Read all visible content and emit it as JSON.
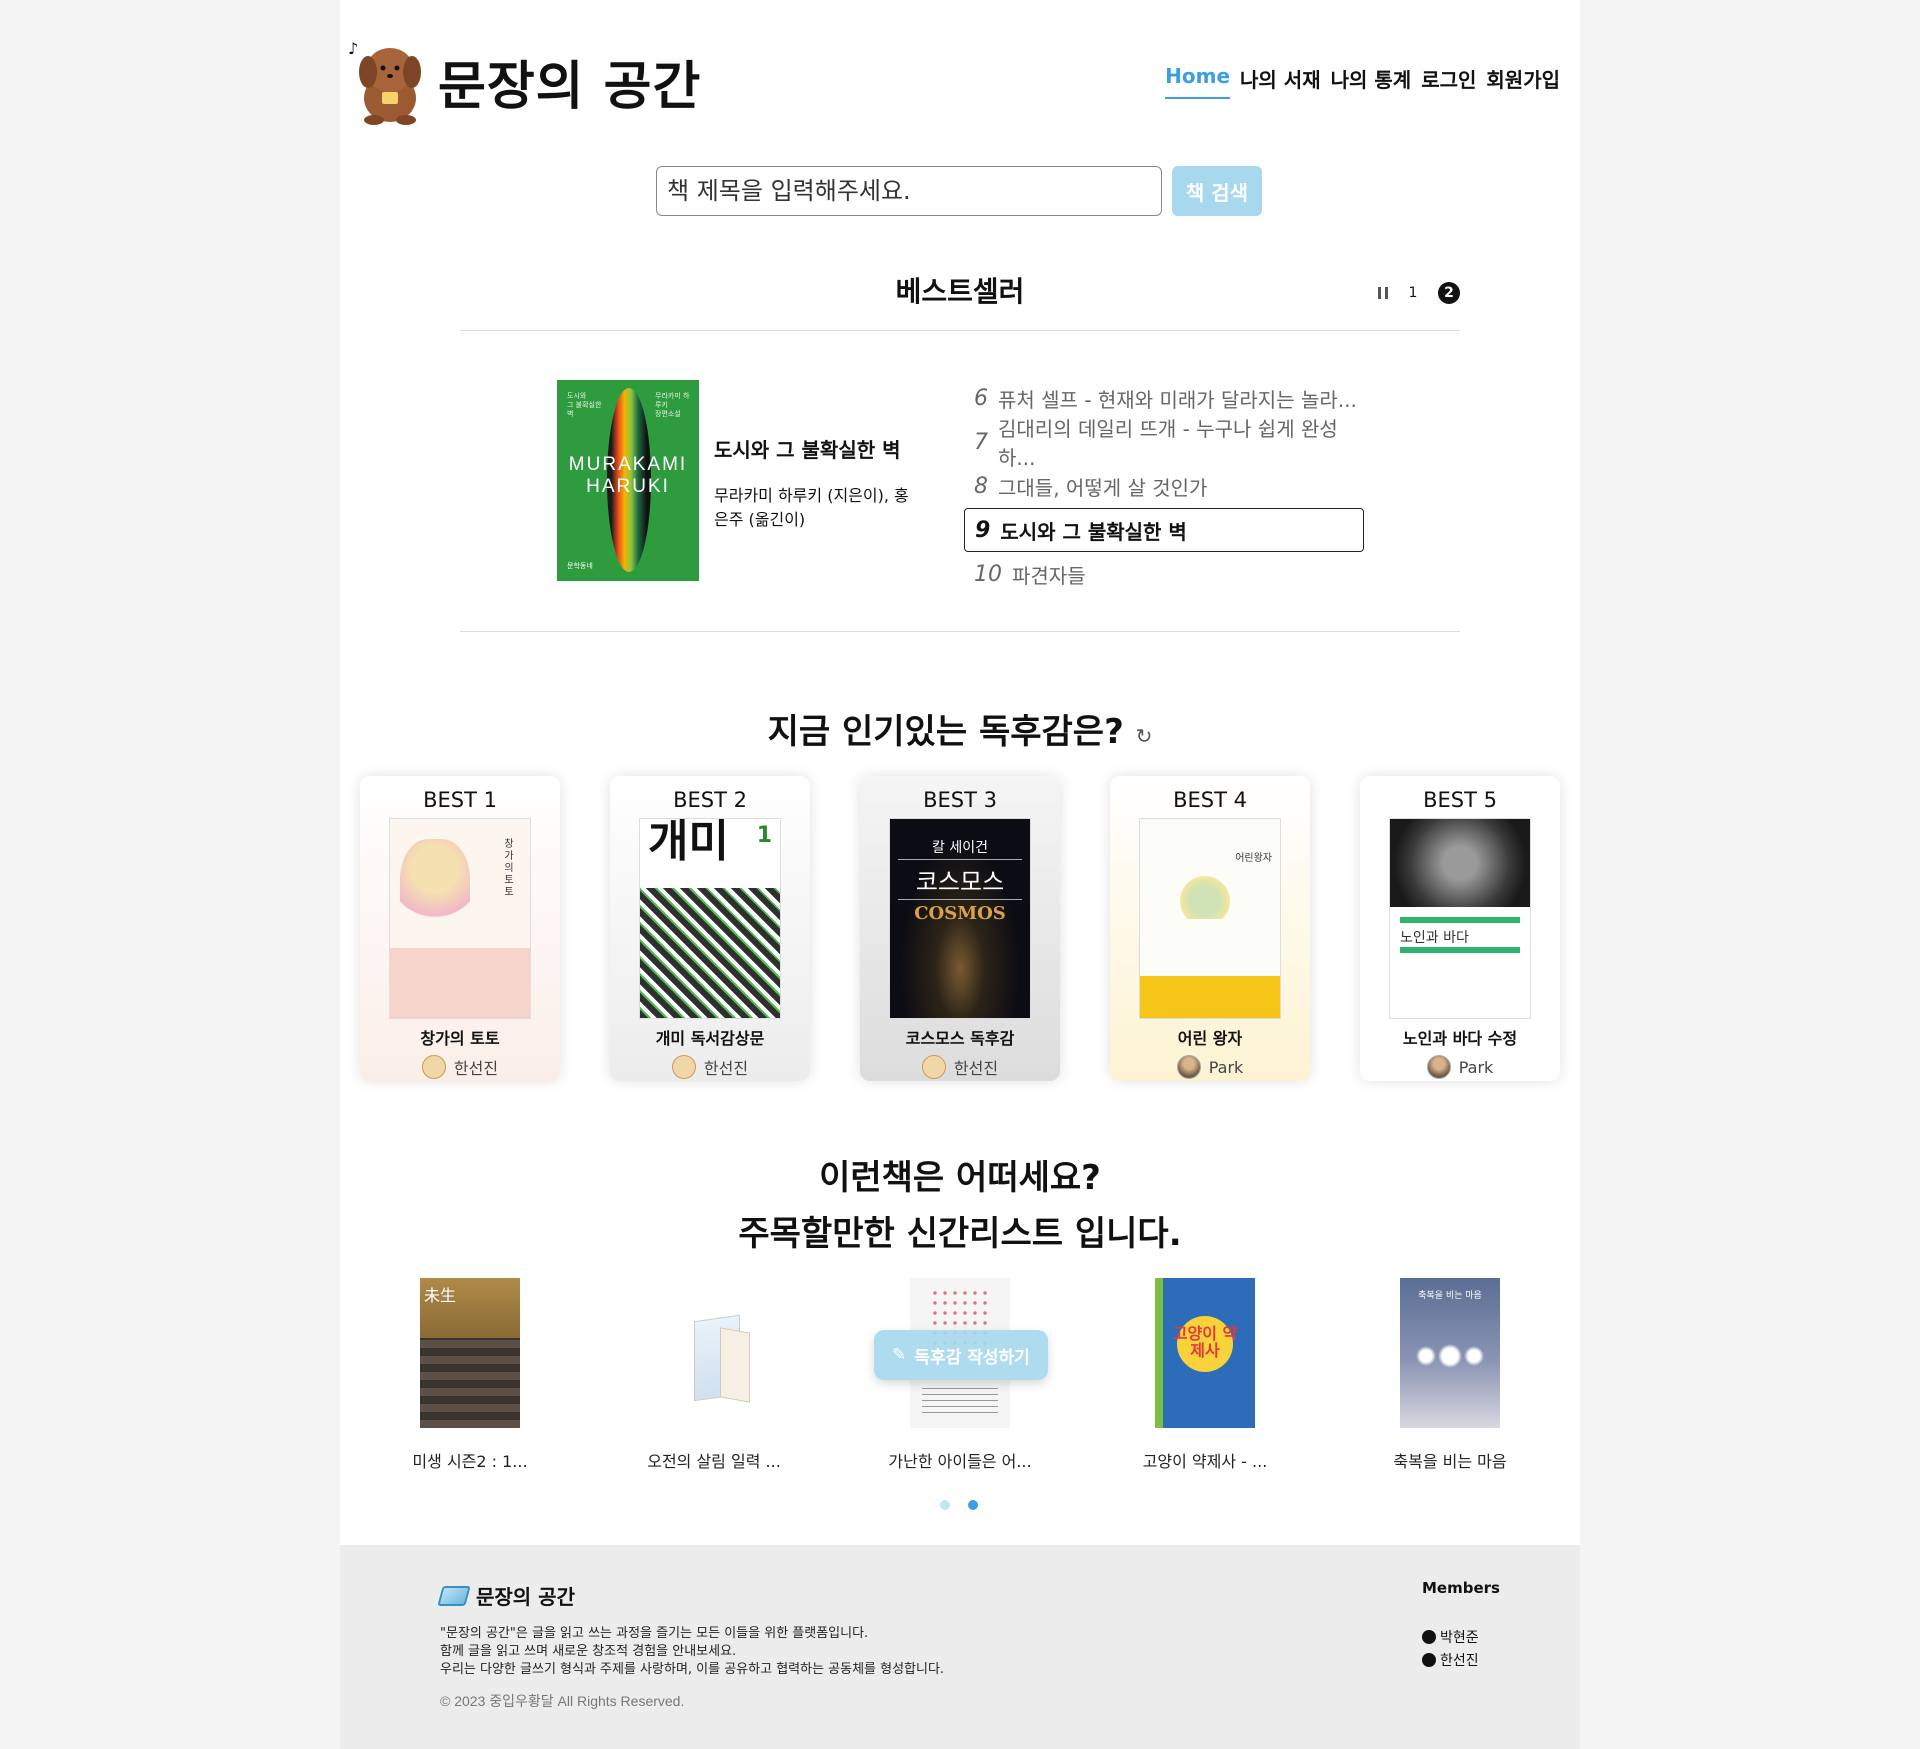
{
  "header": {
    "title": "문장의 공간",
    "nav": [
      "Home",
      "나의 서재",
      "나의 통계",
      "로그인",
      "회원가입"
    ]
  },
  "search": {
    "placeholder": "책 제목을 입력해주세요.",
    "button": "책 검색"
  },
  "bestseller": {
    "title": "베스트셀러",
    "pages": [
      "1",
      "2"
    ],
    "current_page": "2",
    "featured": {
      "title": "도시와 그 불확실한 벽",
      "author": "무라카미 하루키 (지은이), 홍은주 (옮긴이)",
      "cover_text": "MURAKAMI HARUKI"
    },
    "list": [
      {
        "rank": "6",
        "title": "퓨처 셀프 - 현재와 미래가 달라지는 놀라..."
      },
      {
        "rank": "7",
        "title": "김대리의 데일리 뜨개 - 누구나 쉽게 완성하..."
      },
      {
        "rank": "8",
        "title": "그대들, 어떻게 살 것인가"
      },
      {
        "rank": "9",
        "title": "도시와 그 불확실한 벽"
      },
      {
        "rank": "10",
        "title": "파견자들"
      }
    ],
    "active_index": 3
  },
  "popular": {
    "title": "지금 인기있는 독후감은?",
    "refresh_icon": "refresh-icon",
    "cards": [
      {
        "best": "BEST 1",
        "title": "창가의 토토",
        "reviewer": "한선진"
      },
      {
        "best": "BEST 2",
        "title": "개미 독서감상문",
        "reviewer": "한선진"
      },
      {
        "best": "BEST 3",
        "title": "코스모스 독후감",
        "reviewer": "한선진"
      },
      {
        "best": "BEST 4",
        "title": "어린 왕자",
        "reviewer": "Park"
      },
      {
        "best": "BEST 5",
        "title": "노인과 바다 수정",
        "reviewer": "Park"
      }
    ],
    "cover_texts": {
      "c2_big": "개미",
      "c2_num": "1",
      "c3_author": "칼 세이건",
      "c3_title": "코스모스",
      "c3_en": "COSMOS",
      "c4_title": "어린왕자",
      "c5_title": "노인과 바다"
    }
  },
  "new_books": {
    "title_line1": "이런책은 어떠세요?",
    "title_line2": "주목할만한 신간리스트 입니다.",
    "items": [
      {
        "title": "미생 시즌2 : 1..."
      },
      {
        "title": "오전의 살림 일력 ..."
      },
      {
        "title": "가난한 아이들은 어..."
      },
      {
        "title": "고양이 약제사 - ..."
      },
      {
        "title": "축복을 비는 마음"
      }
    ],
    "cover_texts": {
      "nc1": "未生",
      "nc4": "고양이 약제사",
      "nc5": "축복을 비는 마음"
    },
    "write_button": "독후감 작성하기",
    "slides": 2,
    "active_slide": 2
  },
  "footer": {
    "brand": "문장의 공간",
    "desc": [
      "\"문장의 공간\"은 글을 읽고 쓰는 과정을 즐기는 모든 이들을 위한 플랫폼입니다.",
      "함께 글을 읽고 쓰며 새로운 창조적 경험을 안내보세요.",
      "우리는 다양한 글쓰기 형식과 주제를 사랑하며, 이를 공유하고 협력하는 공동체를 형성합니다."
    ],
    "copyright": "© 2023 중입우황달 All Rights Reserved.",
    "members_label": "Members",
    "members": [
      "박현준",
      "한선진"
    ]
  },
  "colors": {
    "accent": "#3aa0e0",
    "button_bg": "#a8d8ee"
  }
}
